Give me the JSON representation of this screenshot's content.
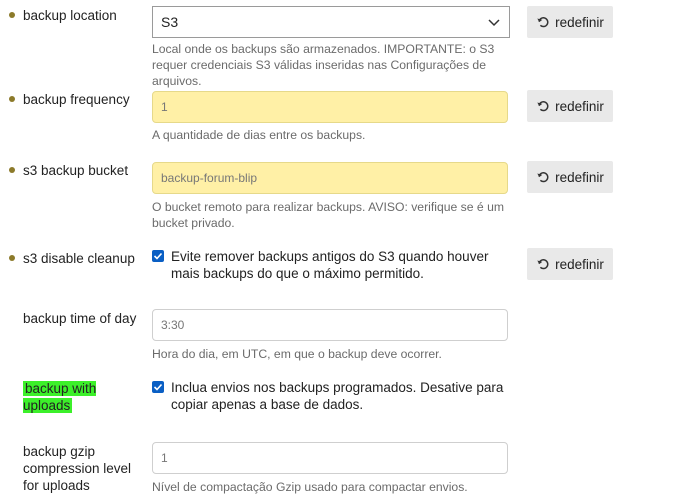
{
  "reset_label": "redefinir",
  "settings": [
    {
      "label": "backup location",
      "value": "S3",
      "description": "Local onde os backups são armazenados. IMPORTANTE: o S3 requer credenciais S3 válidas inseridas nas Configurações de arquivos."
    },
    {
      "label": "backup frequency",
      "value": "1",
      "description": "A quantidade de dias entre os backups."
    },
    {
      "label": "s3 backup bucket",
      "value": "backup-forum-blip",
      "description": "O bucket remoto para realizar backups. AVISO: verifique se é um bucket privado."
    },
    {
      "label": "s3 disable cleanup",
      "checkbox_text": "Evite remover backups antigos do S3 quando houver mais backups do que o máximo permitido."
    },
    {
      "label": "backup time of day",
      "value": "3:30",
      "description": "Hora do dia, em UTC, em que o backup deve ocorrer."
    },
    {
      "label": "backup with uploads",
      "checkbox_text": "Inclua envios nos backups programados. Desative para copiar apenas a base de dados."
    },
    {
      "label": "backup gzip compression level for uploads",
      "value": "1",
      "description": "Nível de compactação Gzip usado para compactar envios."
    }
  ],
  "colors": {
    "highlight": "#3cf02a",
    "modified_field": "#fff0a6",
    "checkbox": "#0a5fc4",
    "modified_dot": "#8c7a2a"
  }
}
